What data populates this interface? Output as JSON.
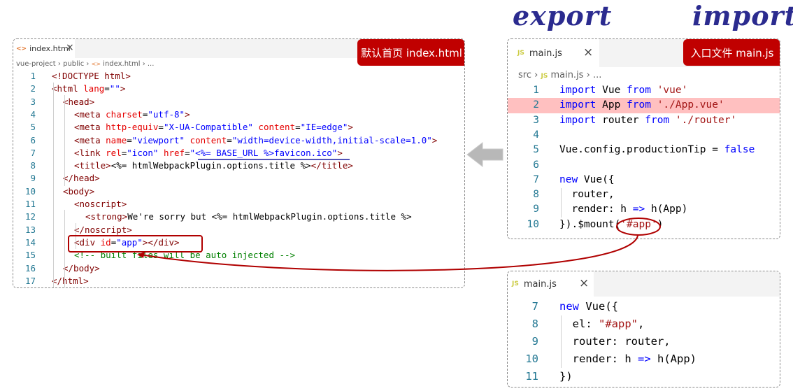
{
  "labels": {
    "export": "export",
    "import": "import"
  },
  "left_panel": {
    "tab_icon": "<>",
    "tab_title": "index.html",
    "close": "×",
    "breadcrumb": {
      "p1": "vue-project",
      "sep": "›",
      "p2": "public",
      "icon": "<>",
      "p3": "index.html",
      "p4": "..."
    },
    "badge": "默认首页 index.html",
    "lines": [
      {
        "n": "1",
        "parts": [
          [
            "tag",
            "<!DOCTYPE html>"
          ]
        ]
      },
      {
        "n": "2",
        "parts": [
          [
            "tag",
            "<html "
          ],
          [
            "attr",
            "lang"
          ],
          [
            "txt",
            "="
          ],
          [
            "val",
            "\"\""
          ],
          [
            "tag",
            ">"
          ]
        ]
      },
      {
        "n": "3",
        "parts": [
          [
            "tag",
            "<head>"
          ]
        ]
      },
      {
        "n": "4",
        "parts": [
          [
            "tag",
            "<meta "
          ],
          [
            "attr",
            "charset"
          ],
          [
            "txt",
            "="
          ],
          [
            "val",
            "\"utf-8\""
          ],
          [
            "tag",
            ">"
          ]
        ]
      },
      {
        "n": "5",
        "parts": [
          [
            "tag",
            "<meta "
          ],
          [
            "attr",
            "http-equiv"
          ],
          [
            "txt",
            "="
          ],
          [
            "val",
            "\"X-UA-Compatible\""
          ],
          [
            "txt",
            " "
          ],
          [
            "attr",
            "content"
          ],
          [
            "txt",
            "="
          ],
          [
            "val",
            "\"IE=edge\""
          ],
          [
            "tag",
            ">"
          ]
        ]
      },
      {
        "n": "6",
        "parts": [
          [
            "tag",
            "<meta "
          ],
          [
            "attr",
            "name"
          ],
          [
            "txt",
            "="
          ],
          [
            "val",
            "\"viewport\""
          ],
          [
            "txt",
            " "
          ],
          [
            "attr",
            "content"
          ],
          [
            "txt",
            "="
          ],
          [
            "val",
            "\"width=device-width,initial-scale=1.0\""
          ],
          [
            "tag",
            ">"
          ]
        ]
      },
      {
        "n": "7",
        "parts": [
          [
            "tag",
            "<link "
          ],
          [
            "attr",
            "rel"
          ],
          [
            "txt",
            "="
          ],
          [
            "val",
            "\"icon\""
          ],
          [
            "txt",
            " "
          ],
          [
            "attr",
            "href"
          ],
          [
            "txt",
            "="
          ],
          [
            "val",
            "\"<%= BASE_URL %>favicon.ico\""
          ],
          [
            "tag",
            ">"
          ]
        ]
      },
      {
        "n": "8",
        "parts": [
          [
            "tag",
            "<title>"
          ],
          [
            "txt",
            "<%= htmlWebpackPlugin.options.title %>"
          ],
          [
            "tag",
            "</title>"
          ]
        ]
      },
      {
        "n": "9",
        "parts": [
          [
            "tag",
            "</head>"
          ]
        ]
      },
      {
        "n": "10",
        "parts": [
          [
            "tag",
            "<body>"
          ]
        ]
      },
      {
        "n": "11",
        "parts": [
          [
            "tag",
            "<noscript>"
          ]
        ]
      },
      {
        "n": "12",
        "parts": [
          [
            "tag",
            "<strong>"
          ],
          [
            "txt",
            "We're sorry but <%= htmlWebpackPlugin.options.title %>"
          ]
        ]
      },
      {
        "n": "13",
        "parts": [
          [
            "tag",
            "</noscript>"
          ]
        ]
      },
      {
        "n": "14",
        "parts": [
          [
            "tag",
            "<div "
          ],
          [
            "attr",
            "id"
          ],
          [
            "txt",
            "="
          ],
          [
            "val",
            "\"app\""
          ],
          [
            "tag",
            "></div>"
          ]
        ]
      },
      {
        "n": "15",
        "parts": [
          [
            "cmt",
            "<!-- built files will be auto injected -->"
          ]
        ]
      },
      {
        "n": "16",
        "parts": [
          [
            "tag",
            "</body>"
          ]
        ]
      },
      {
        "n": "17",
        "parts": [
          [
            "tag",
            "</html>"
          ]
        ]
      }
    ]
  },
  "main_panel": {
    "tab_icon": "JS",
    "tab_title": "main.js",
    "close": "×",
    "breadcrumb": {
      "p1": "src",
      "sep": "›",
      "icon": "JS",
      "p2": "main.js",
      "p3": "..."
    },
    "badge": "入口文件 main.js",
    "lines": [
      {
        "n": "1",
        "parts": [
          [
            "kw",
            "import"
          ],
          [
            "txt",
            " Vue "
          ],
          [
            "kw",
            "from"
          ],
          [
            "txt",
            " "
          ],
          [
            "str",
            "'vue'"
          ]
        ]
      },
      {
        "n": "2",
        "parts": [
          [
            "kw",
            "import"
          ],
          [
            "txt",
            " App "
          ],
          [
            "kw",
            "from"
          ],
          [
            "txt",
            " "
          ],
          [
            "str",
            "'./App.vue'"
          ]
        ]
      },
      {
        "n": "3",
        "parts": [
          [
            "kw",
            "import"
          ],
          [
            "txt",
            " router "
          ],
          [
            "kw",
            "from"
          ],
          [
            "txt",
            " "
          ],
          [
            "str",
            "'./router'"
          ]
        ]
      },
      {
        "n": "4",
        "parts": []
      },
      {
        "n": "5",
        "parts": [
          [
            "txt",
            "Vue.config.productionTip = "
          ],
          [
            "kw",
            "false"
          ]
        ]
      },
      {
        "n": "6",
        "parts": []
      },
      {
        "n": "7",
        "parts": [
          [
            "kw",
            "new"
          ],
          [
            "txt",
            " Vue({"
          ]
        ]
      },
      {
        "n": "8",
        "parts": [
          [
            "txt",
            "  router,"
          ]
        ]
      },
      {
        "n": "9",
        "parts": [
          [
            "txt",
            "  render: h "
          ],
          [
            "kw",
            "=>"
          ],
          [
            "txt",
            " h(App)"
          ]
        ]
      },
      {
        "n": "10",
        "parts": [
          [
            "txt",
            "}).$mount("
          ],
          [
            "str",
            "'#app'"
          ],
          [
            "txt",
            ")"
          ]
        ]
      }
    ],
    "highlight_line": 2,
    "highlight_color": "#ffc0c0"
  },
  "main2_panel": {
    "tab_icon": "JS",
    "tab_title": "main.js",
    "close": "×",
    "lines": [
      {
        "n": "7",
        "parts": [
          [
            "kw",
            "new"
          ],
          [
            "txt",
            " Vue({"
          ]
        ]
      },
      {
        "n": "8",
        "parts": [
          [
            "txt",
            "  el: "
          ],
          [
            "str",
            "\"#app\""
          ],
          [
            "txt",
            ","
          ]
        ]
      },
      {
        "n": "9",
        "parts": [
          [
            "txt",
            "  router: router,"
          ]
        ]
      },
      {
        "n": "10",
        "parts": [
          [
            "txt",
            "  render: h "
          ],
          [
            "kw",
            "=>"
          ],
          [
            "txt",
            " h(App)"
          ]
        ]
      },
      {
        "n": "11",
        "parts": [
          [
            "txt",
            "})"
          ]
        ]
      }
    ]
  },
  "colors": {
    "annotation_red": "#b00000",
    "badge_red": "#c00000",
    "handwriting": "#2b2b8f",
    "underline_blue": "#1a1aa0"
  },
  "icons": [
    "html-file-icon",
    "js-file-icon",
    "close-icon",
    "chevron-right-icon",
    "gray-arrow-left-icon"
  ]
}
